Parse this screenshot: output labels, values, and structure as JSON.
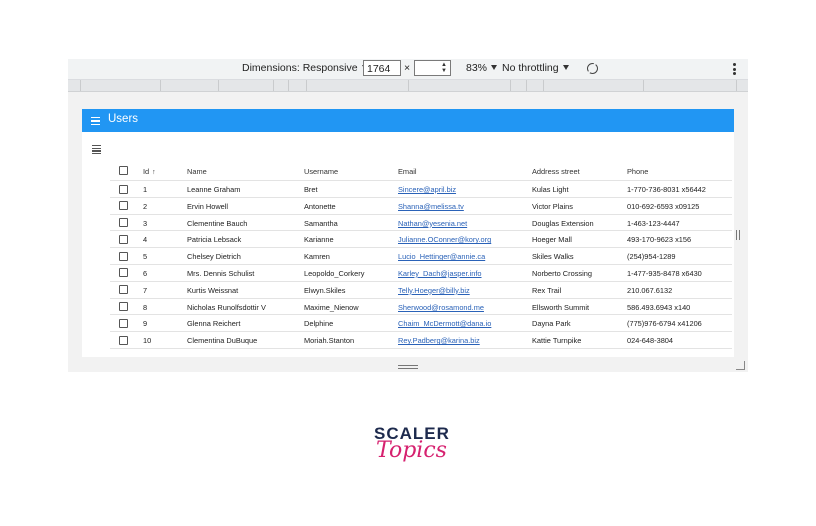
{
  "devtools": {
    "dimensions_label": "Dimensions: Responsive",
    "width_value": "1764",
    "times": "×",
    "height_value": "",
    "zoom": "83%",
    "throttling": "No throttling"
  },
  "app": {
    "title": "Users"
  },
  "table": {
    "headers": [
      "Id",
      "Name",
      "Username",
      "Email",
      "Address street",
      "Phone"
    ],
    "sort_indicator": "↑",
    "rows": [
      {
        "id": "1",
        "name": "Leanne Graham",
        "username": "Bret",
        "email": "Sincere@april.biz",
        "street": "Kulas Light",
        "phone": "1-770-736-8031 x56442"
      },
      {
        "id": "2",
        "name": "Ervin Howell",
        "username": "Antonette",
        "email": "Shanna@melissa.tv",
        "street": "Victor Plains",
        "phone": "010-692-6593 x09125"
      },
      {
        "id": "3",
        "name": "Clementine Bauch",
        "username": "Samantha",
        "email": "Nathan@yesenia.net",
        "street": "Douglas Extension",
        "phone": "1-463-123-4447"
      },
      {
        "id": "4",
        "name": "Patricia Lebsack",
        "username": "Karianne",
        "email": "Julianne.OConner@kory.org",
        "street": "Hoeger Mall",
        "phone": "493-170-9623 x156"
      },
      {
        "id": "5",
        "name": "Chelsey Dietrich",
        "username": "Kamren",
        "email": "Lucio_Hettinger@annie.ca",
        "street": "Skiles Walks",
        "phone": "(254)954-1289"
      },
      {
        "id": "6",
        "name": "Mrs. Dennis Schulist",
        "username": "Leopoldo_Corkery",
        "email": "Karley_Dach@jasper.info",
        "street": "Norberto Crossing",
        "phone": "1-477-935-8478 x6430"
      },
      {
        "id": "7",
        "name": "Kurtis Weissnat",
        "username": "Elwyn.Skiles",
        "email": "Telly.Hoeger@billy.biz",
        "street": "Rex Trail",
        "phone": "210.067.6132"
      },
      {
        "id": "8",
        "name": "Nicholas Runolfsdottir V",
        "username": "Maxime_Nienow",
        "email": "Sherwood@rosamond.me",
        "street": "Ellsworth Summit",
        "phone": "586.493.6943 x140"
      },
      {
        "id": "9",
        "name": "Glenna Reichert",
        "username": "Delphine",
        "email": "Chaim_McDermott@dana.io",
        "street": "Dayna Park",
        "phone": "(775)976-6794 x41206"
      },
      {
        "id": "10",
        "name": "Clementina DuBuque",
        "username": "Moriah.Stanton",
        "email": "Rey.Padberg@karina.biz",
        "street": "Kattie Turnpike",
        "phone": "024-648-3804"
      }
    ]
  },
  "logo": {
    "top": "SCALER",
    "bottom": "Topics"
  },
  "colors": {
    "appbar": "#2196f3",
    "brand_pink": "#d6216f",
    "brand_navy": "#1d2a4d"
  }
}
